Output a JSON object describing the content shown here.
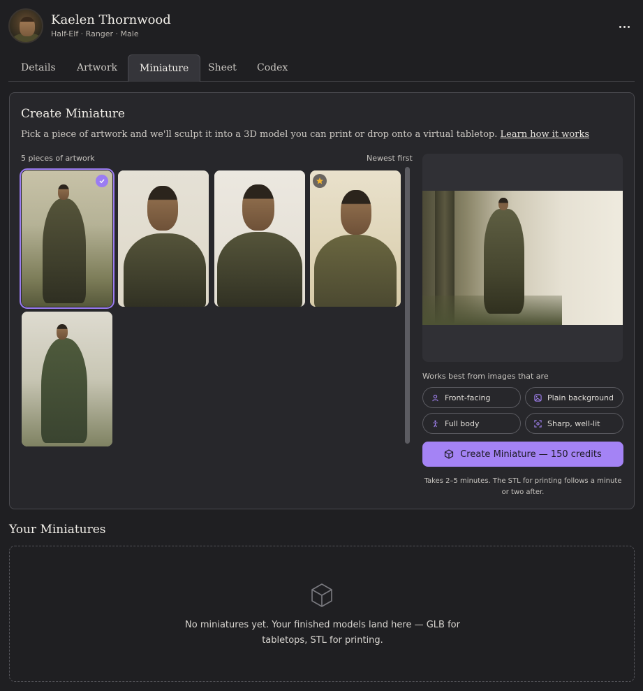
{
  "character": {
    "name": "Kaelen Thornwood",
    "subtitle": "Half-Elf · Ranger · Male",
    "more_icon": "more-horizontal-icon"
  },
  "tabs": [
    {
      "label": "Details",
      "active": false
    },
    {
      "label": "Artwork",
      "active": false
    },
    {
      "label": "Miniature",
      "active": true
    },
    {
      "label": "Sheet",
      "active": false
    },
    {
      "label": "Codex",
      "active": false
    }
  ],
  "create": {
    "title": "Create Miniature",
    "description": "Pick a piece of artwork and we'll sculpt it into a 3D model you can print or drop onto a virtual tabletop.",
    "learn_link": "Learn how it works",
    "count_label": "5 pieces of artwork",
    "sort_label": "Newest first",
    "artworks": [
      {
        "subject": "full-body ranger in forest",
        "selected": true,
        "starred": false
      },
      {
        "subject": "portrait facing left",
        "selected": false,
        "starred": false
      },
      {
        "subject": "portrait facing right",
        "selected": false,
        "starred": false
      },
      {
        "subject": "portrait watercolor",
        "selected": false,
        "starred": true
      },
      {
        "subject": "full-body with bow in pines",
        "selected": false,
        "starred": false
      }
    ],
    "works_best_label": "Works best from images that are",
    "tips": [
      {
        "label": "Front-facing",
        "icon": "user-icon"
      },
      {
        "label": "Plain background",
        "icon": "image-icon"
      },
      {
        "label": "Full body",
        "icon": "person-standing-icon"
      },
      {
        "label": "Sharp, well-lit",
        "icon": "focus-icon"
      }
    ],
    "button_label": "Create Miniature — 150 credits",
    "button_icon": "cube-icon",
    "footnote": "Takes 2–5 minutes. The STL for printing follows a minute or two after."
  },
  "miniatures": {
    "title": "Your Miniatures",
    "empty_icon": "cube-icon",
    "empty_text": "No miniatures yet. Your finished models land here — GLB for tabletops, STL for printing."
  },
  "colors": {
    "background": "#1f1f22",
    "panel": "#27272b",
    "accent": "#a483f5",
    "selected_outline": "#9b7cf2"
  }
}
